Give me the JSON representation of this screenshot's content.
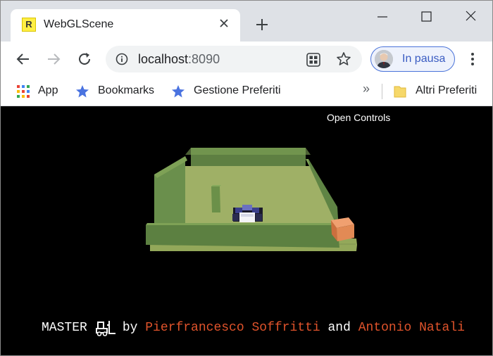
{
  "browser": {
    "tab": {
      "favicon_letter": "R",
      "title": "WebGLScene"
    },
    "address": {
      "host": "localhost",
      "port": ":8090"
    },
    "profile": {
      "label": "In pausa"
    },
    "bookmarks": {
      "items": [
        {
          "label": "App",
          "icon": "apps-grid-icon"
        },
        {
          "label": "Bookmarks",
          "icon": "star-icon"
        },
        {
          "label": "Gestione Preferiti",
          "icon": "star-icon"
        }
      ],
      "more": "»",
      "other": {
        "label": "Altri Preferiti",
        "icon": "folder-icon"
      }
    }
  },
  "page": {
    "open_controls": "Open Controls",
    "credits": {
      "prefix": "MASTER",
      "logo_icon": "forklift-icon",
      "by": "by",
      "author1": "Pierfrancesco Soffritti",
      "and": "and",
      "author2": "Antonio Natali"
    }
  },
  "colors": {
    "author": "#e0532b",
    "floor": "#9fb066",
    "wall": "#6a8f4c",
    "box": "#e28a55"
  }
}
